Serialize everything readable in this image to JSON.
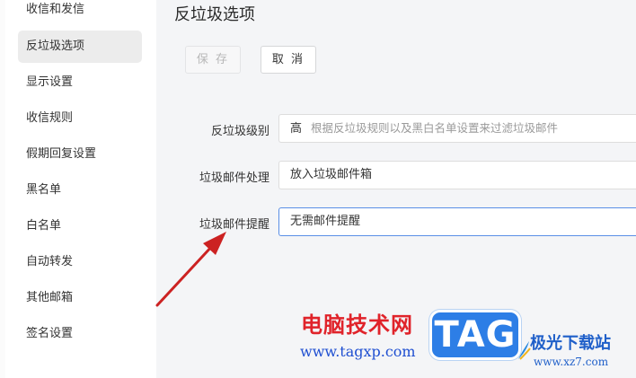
{
  "sidebar": {
    "items": [
      {
        "label": "收信和发信",
        "active": false
      },
      {
        "label": "反垃圾选项",
        "active": true
      },
      {
        "label": "显示设置",
        "active": false
      },
      {
        "label": "收信规则",
        "active": false
      },
      {
        "label": "假期回复设置",
        "active": false
      },
      {
        "label": "黑名单",
        "active": false
      },
      {
        "label": "白名单",
        "active": false
      },
      {
        "label": "自动转发",
        "active": false
      },
      {
        "label": "其他邮箱",
        "active": false
      },
      {
        "label": "签名设置",
        "active": false
      }
    ]
  },
  "main": {
    "title": "反垃圾选项",
    "save_label": "保 存",
    "cancel_label": "取 消",
    "fields": [
      {
        "label": "反垃圾级别",
        "value": "高",
        "hint": "根据反垃圾规则以及黑白名单设置来过滤垃圾邮件"
      },
      {
        "label": "垃圾邮件处理",
        "value": "放入垃圾邮件箱"
      },
      {
        "label": "垃圾邮件提醒",
        "value": "无需邮件提醒"
      }
    ]
  },
  "watermark": {
    "cn": "电脑技术网",
    "url": "www.tagxp.com",
    "tag": "TAG",
    "site_cn": "极光下载站",
    "site_url": "www.xz7.com"
  },
  "colors": {
    "accent_arrow": "#cc2222",
    "focus_border": "#5a8fe6"
  }
}
